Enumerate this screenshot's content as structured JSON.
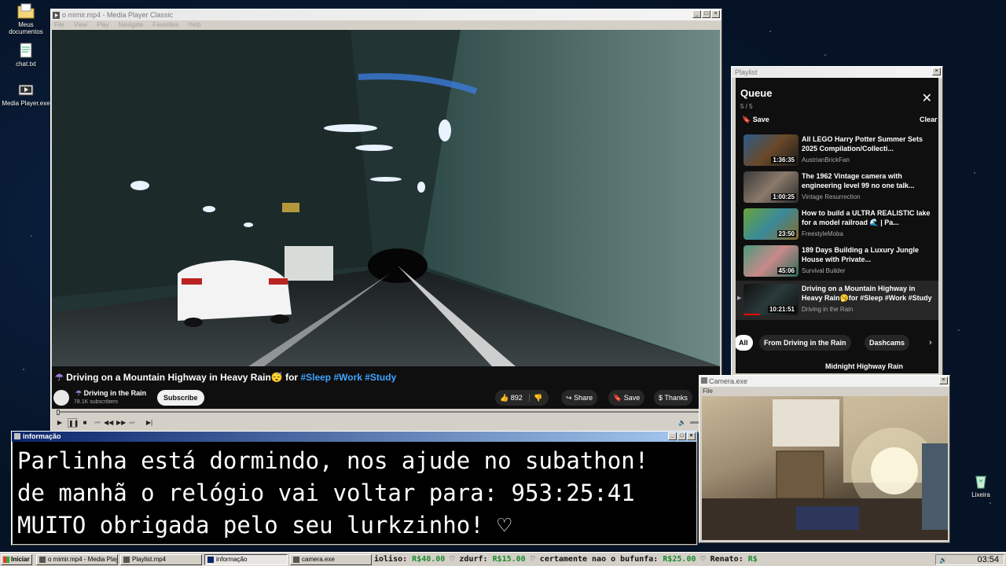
{
  "desktop": {
    "icons": [
      {
        "label": "Meus documentos",
        "icon": "folder-icon"
      },
      {
        "label": "chat.txt",
        "icon": "notepad-icon"
      },
      {
        "label": "Media Player.exe",
        "icon": "media-player-icon"
      },
      {
        "label": "Lixeira",
        "icon": "recycle-bin-icon"
      }
    ]
  },
  "player": {
    "title": "o mimir.mp4 - Media Player Classic",
    "menu": [
      "File",
      "View",
      "Play",
      "Navigate",
      "Favorites",
      "Help"
    ],
    "video": {
      "title_prefix": "Driving on a Mountain Highway in Heavy Rain",
      "title_mid": " for ",
      "tags": "#Sleep #Work #Study",
      "channel": "Driving in the Rain",
      "subscribers": "78.1K subscribers",
      "subscribe_label": "Subscribe",
      "likes": "892",
      "share_label": "Share",
      "save_label": "Save",
      "thanks_label": "Thanks"
    }
  },
  "playlist": {
    "window_title": "Playlist",
    "heading": "Queue",
    "count": "5 / 5",
    "save_label": "Save",
    "clear_label": "Clear",
    "items": [
      {
        "title": "All LEGO Harry Potter Summer Sets 2025 Compilation/Collecti...",
        "channel": "AustrianBrickFan",
        "duration": "1:36:35",
        "thumb_color": "#3b4a6b"
      },
      {
        "title": "The 1962 Vintage camera with engineering level 99 no one talk...",
        "channel": "Vintage Resurrection",
        "duration": "1:00:25",
        "thumb_color": "#5a4a3e"
      },
      {
        "title": "How to build a ULTRA REALISTIC lake for a model railroad 🌊 | Pa...",
        "channel": "FreestyleMoba",
        "duration": "23:50",
        "thumb_color": "#5f8a2c"
      },
      {
        "title": "189 Days Building a Luxury Jungle House with Private...",
        "channel": "Survival Builder",
        "duration": "45:06",
        "thumb_color": "#3e7a7a"
      },
      {
        "title": "Driving on a Mountain Highway in Heavy Rain🥱for #Sleep #Work #Study",
        "channel": "Driving in the Rain",
        "duration": "10:21:51",
        "thumb_color": "#1f2a2a"
      }
    ],
    "chips": [
      "All",
      "From Driving in the Rain",
      "Dashcams"
    ],
    "next_title": "Midnight Highway Rain"
  },
  "info": {
    "window_title": "informação",
    "lines": [
      "Parlinha está dormindo, nos ajude no subathon!",
      "de manhã o relógio vai voltar para:  953:25:41",
      "MUITO obrigada pelo seu lurkzinho! ♡"
    ]
  },
  "camera": {
    "window_title": "Camera.exe",
    "menu": [
      "File"
    ]
  },
  "taskbar": {
    "start_label": "Iniciar",
    "tasks": [
      "o mimir.mp4 - Media Playe...",
      "Playlist.mp4",
      "informação",
      "camera.exe"
    ],
    "ticker": [
      {
        "name": "ioliso: ",
        "amount": "R$40.00"
      },
      {
        "name": "zdurf: ",
        "amount": "R$15.00"
      },
      {
        "name": "certamente nao o bufunfa: ",
        "amount": "R$25.00"
      },
      {
        "name": "Renato: ",
        "amount": "R$"
      }
    ],
    "clock": "03:54"
  },
  "colors": {
    "title_active": "#0a246a",
    "link_blue": "#3ea6ff",
    "ticker_amount": "#1a8a2a"
  }
}
